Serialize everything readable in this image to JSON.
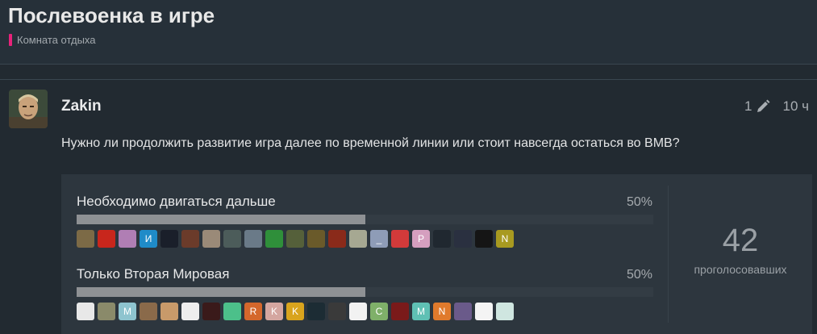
{
  "topic": {
    "title": "Послевоенка в игре",
    "category": "Комната отдыха",
    "category_color": "#e8227a"
  },
  "post": {
    "username": "Zakin",
    "edit_count": "1",
    "edit_icon": "pencil-icon",
    "time": "10 ч",
    "text": "Нужно ли продолжить развитие игра далее по временной линии или стоит навсегда остаться во ВМВ?"
  },
  "poll": {
    "total": "42",
    "total_label": "проголосовавших",
    "options": [
      {
        "title": "Необходимо двигаться дальше",
        "percent_label": "50%",
        "fraction": 0.5,
        "voters": [
          {
            "bg": "#7c6a46",
            "letter": ""
          },
          {
            "bg": "#c8261c",
            "letter": ""
          },
          {
            "bg": "#b07eb4",
            "letter": ""
          },
          {
            "bg": "#1f8bc8",
            "letter": "И"
          },
          {
            "bg": "#1a1f2a",
            "letter": ""
          },
          {
            "bg": "#6b3b2a",
            "letter": ""
          },
          {
            "bg": "#9a8a78",
            "letter": ""
          },
          {
            "bg": "#4c5c5a",
            "letter": ""
          },
          {
            "bg": "#6a7a88",
            "letter": ""
          },
          {
            "bg": "#2f8f3a",
            "letter": ""
          },
          {
            "bg": "#55603a",
            "letter": ""
          },
          {
            "bg": "#6a5a2a",
            "letter": ""
          },
          {
            "bg": "#8a2a1a",
            "letter": ""
          },
          {
            "bg": "#a6a892",
            "letter": ""
          },
          {
            "bg": "#8e9cb7",
            "letter": "_"
          },
          {
            "bg": "#d23a3a",
            "letter": ""
          },
          {
            "bg": "#d59fbf",
            "letter": "P"
          },
          {
            "bg": "#202830",
            "letter": ""
          },
          {
            "bg": "#2a3040",
            "letter": ""
          },
          {
            "bg": "#151515",
            "letter": ""
          },
          {
            "bg": "#a89a20",
            "letter": "N"
          }
        ]
      },
      {
        "title": "Только Вторая Мировая",
        "percent_label": "50%",
        "fraction": 0.5,
        "voters": [
          {
            "bg": "#e8e8e8",
            "letter": ""
          },
          {
            "bg": "#8a8a6a",
            "letter": ""
          },
          {
            "bg": "#8ec4cf",
            "letter": "M"
          },
          {
            "bg": "#8a6a4a",
            "letter": ""
          },
          {
            "bg": "#c89a6a",
            "letter": ""
          },
          {
            "bg": "#eeeeee",
            "letter": ""
          },
          {
            "bg": "#3a1a1a",
            "letter": ""
          },
          {
            "bg": "#4cc08a",
            "letter": ""
          },
          {
            "bg": "#d4672c",
            "letter": "R"
          },
          {
            "bg": "#d4a6a0",
            "letter": "K"
          },
          {
            "bg": "#d9a41d",
            "letter": "K"
          },
          {
            "bg": "#1c2c34",
            "letter": ""
          },
          {
            "bg": "#3a3a3a",
            "letter": ""
          },
          {
            "bg": "#f2f2f2",
            "letter": ""
          },
          {
            "bg": "#7fb069",
            "letter": "C"
          },
          {
            "bg": "#7a1a1a",
            "letter": ""
          },
          {
            "bg": "#5fc0b4",
            "letter": "M"
          },
          {
            "bg": "#e07a2c",
            "letter": "N"
          },
          {
            "bg": "#6a5a8a",
            "letter": ""
          },
          {
            "bg": "#f4f4f4",
            "letter": ""
          },
          {
            "bg": "#cfe6e0",
            "letter": ""
          }
        ]
      }
    ]
  },
  "colors": {
    "background": "#222a31",
    "poll_background": "#2d363e",
    "bar_fill": "#8e9194"
  }
}
